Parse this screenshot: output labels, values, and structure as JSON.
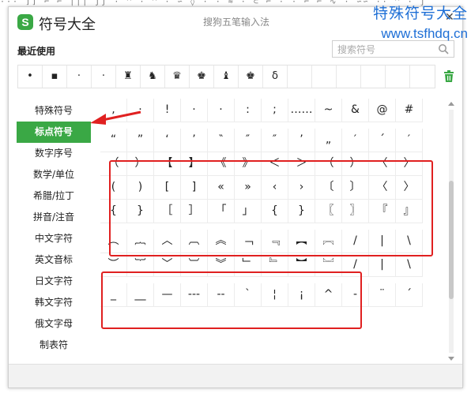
{
  "top_strip": "··· ]] ⌐ ⌐ ||| ∫∫ · ^ · ^ · ∽ ◊ · · ≈ · ⊂ ⌐ · · ⌐ ⌐ ∿ · ∽∽ ·· ^ · ∫",
  "window": {
    "title": "符号大全",
    "ime_name": "搜狗五笔输入法",
    "close": "✕",
    "logo_char": "S",
    "accent_color": "#3aa845"
  },
  "watermark": {
    "line1": "特殊符号大全",
    "line2": "www.tsfhdq.cn",
    "color": "#1e6fd6"
  },
  "recent": {
    "label": "最近使用",
    "items": [
      "•",
      "▪",
      "·",
      "·",
      "♜",
      "♞",
      "♛",
      "♚",
      "♝",
      "♚",
      "δ",
      "",
      "",
      "",
      "",
      "",
      ""
    ]
  },
  "search": {
    "placeholder": "搜索符号"
  },
  "sidebar": {
    "items": [
      {
        "label": "特殊符号",
        "active": false
      },
      {
        "label": "标点符号",
        "active": true
      },
      {
        "label": "数字序号",
        "active": false
      },
      {
        "label": "数学/单位",
        "active": false
      },
      {
        "label": "希腊/拉丁",
        "active": false
      },
      {
        "label": "拼音/注音",
        "active": false
      },
      {
        "label": "中文字符",
        "active": false
      },
      {
        "label": "英文音标",
        "active": false
      },
      {
        "label": "日文字符",
        "active": false
      },
      {
        "label": "韩文字符",
        "active": false
      },
      {
        "label": "俄文字母",
        "active": false
      },
      {
        "label": "制表符",
        "active": false
      }
    ]
  },
  "symbols": {
    "rows": [
      [
        ",",
        "·",
        "!",
        "·",
        "·",
        ":",
        ";",
        "……",
        "~",
        "&",
        "@",
        "#"
      ],
      [],
      [
        "“",
        "”",
        "‘",
        "’",
        "‶",
        "″",
        "″",
        "’",
        "„",
        "′",
        "´",
        "′"
      ],
      [
        "（",
        "）",
        "【",
        "】",
        "《",
        "》",
        "＜",
        "＞",
        "（",
        "）",
        "〈",
        "〉"
      ],
      [
        "(",
        ")",
        "[",
        "]",
        "«",
        "»",
        "‹",
        "›",
        "〔",
        "〕",
        "〈",
        "〉"
      ],
      [
        "{",
        "}",
        "［",
        "］",
        "「",
        "」",
        "{",
        "}",
        "〖",
        "〗",
        "『",
        "』"
      ],
      [],
      [
        "︵",
        "︷",
        "︿",
        "︹",
        "︽",
        "﹁",
        "﹃",
        "︻",
        "︗",
        "/",
        "|",
        "\\"
      ],
      [
        "︶",
        "︸",
        "﹀",
        "︺",
        "︾",
        "﹂",
        "﹄",
        "︼",
        "︘",
        "/",
        "|",
        "\\"
      ],
      [],
      [
        "_",
        "__",
        "—",
        "---",
        "--",
        "`",
        "¦",
        "¡",
        "^",
        "-",
        "¨",
        "´"
      ]
    ]
  }
}
